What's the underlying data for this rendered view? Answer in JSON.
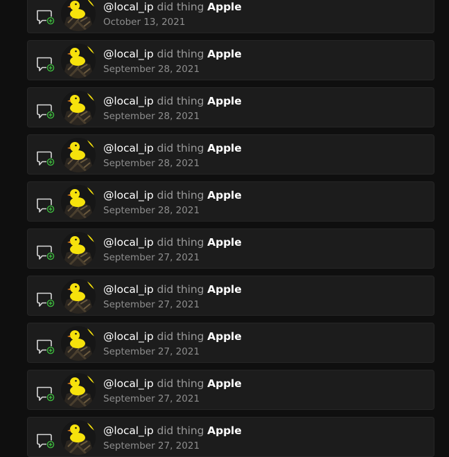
{
  "colors": {
    "background": "#0f0f0f",
    "card": "#1c1c1c",
    "card_border": "#262626",
    "text_primary": "#ffffff",
    "text_secondary": "#9a9a9a",
    "accent_green": "#3fbf3f",
    "duck_yellow": "#f6e20c"
  },
  "activities": [
    {
      "handle": "@local_ip",
      "action": "did thing",
      "target": "Apple",
      "date": "October 13, 2021",
      "icon": "comment-add-icon",
      "avatar": "rubber-duck-avatar"
    },
    {
      "handle": "@local_ip",
      "action": "did thing",
      "target": "Apple",
      "date": "September 28, 2021",
      "icon": "comment-add-icon",
      "avatar": "rubber-duck-avatar"
    },
    {
      "handle": "@local_ip",
      "action": "did thing",
      "target": "Apple",
      "date": "September 28, 2021",
      "icon": "comment-add-icon",
      "avatar": "rubber-duck-avatar"
    },
    {
      "handle": "@local_ip",
      "action": "did thing",
      "target": "Apple",
      "date": "September 28, 2021",
      "icon": "comment-add-icon",
      "avatar": "rubber-duck-avatar"
    },
    {
      "handle": "@local_ip",
      "action": "did thing",
      "target": "Apple",
      "date": "September 28, 2021",
      "icon": "comment-add-icon",
      "avatar": "rubber-duck-avatar"
    },
    {
      "handle": "@local_ip",
      "action": "did thing",
      "target": "Apple",
      "date": "September 27, 2021",
      "icon": "comment-add-icon",
      "avatar": "rubber-duck-avatar"
    },
    {
      "handle": "@local_ip",
      "action": "did thing",
      "target": "Apple",
      "date": "September 27, 2021",
      "icon": "comment-add-icon",
      "avatar": "rubber-duck-avatar"
    },
    {
      "handle": "@local_ip",
      "action": "did thing",
      "target": "Apple",
      "date": "September 27, 2021",
      "icon": "comment-add-icon",
      "avatar": "rubber-duck-avatar"
    },
    {
      "handle": "@local_ip",
      "action": "did thing",
      "target": "Apple",
      "date": "September 27, 2021",
      "icon": "comment-add-icon",
      "avatar": "rubber-duck-avatar"
    },
    {
      "handle": "@local_ip",
      "action": "did thing",
      "target": "Apple",
      "date": "September 27, 2021",
      "icon": "comment-add-icon",
      "avatar": "rubber-duck-avatar"
    }
  ]
}
